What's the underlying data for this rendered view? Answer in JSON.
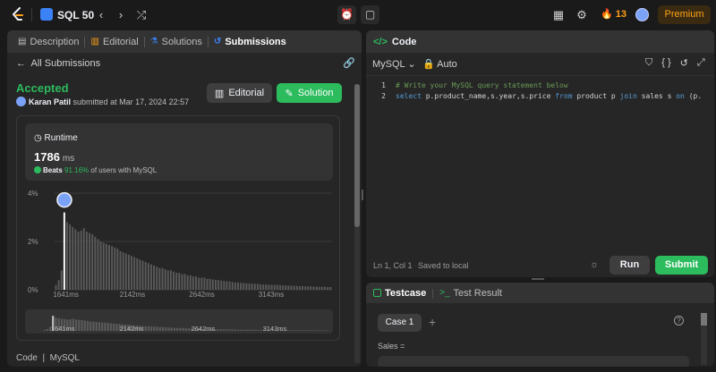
{
  "topbar": {
    "title": "SQL 50",
    "icons": [
      "leetcode-logo",
      "prev-icon",
      "next-icon",
      "shuffle-icon",
      "timer-icon",
      "notes-icon",
      "layout-icon",
      "settings-icon",
      "fire-icon",
      "avatar-icon"
    ],
    "streak_count": "13",
    "premium_label": "Premium",
    "colors": {
      "accent": "#ffa116",
      "success": "#2cbb5d"
    }
  },
  "left": {
    "tabs": [
      {
        "label": "Description",
        "icon": "description-icon"
      },
      {
        "label": "Editorial",
        "icon": "editorial-icon"
      },
      {
        "label": "Solutions",
        "icon": "flask-icon"
      },
      {
        "label": "Submissions",
        "icon": "history-icon",
        "active": true
      }
    ],
    "all_submissions": "All Submissions",
    "status": "Accepted",
    "author": "Karan Patil",
    "submitted_text": "submitted at Mar 17, 2024 22:57",
    "editorial_btn": "Editorial",
    "solution_btn": "Solution",
    "runtime": {
      "title": "Runtime",
      "value": "1786",
      "unit": "ms",
      "beats_label": "Beats",
      "beats_pct": "91.16%",
      "beats_suffix": "of users with MySQL"
    },
    "footer": {
      "code": "Code",
      "lang": "MySQL"
    }
  },
  "chart_data": {
    "type": "bar",
    "y_ticks": [
      "4%",
      "2%",
      "0%"
    ],
    "ylim": [
      0,
      4
    ],
    "x_ticks": [
      "1641ms",
      "2142ms",
      "2642ms",
      "3143ms"
    ],
    "user_bar_index": 3,
    "values": [
      0.2,
      0.4,
      0.8,
      3.2,
      2.8,
      2.7,
      2.6,
      2.5,
      2.4,
      2.45,
      2.55,
      2.4,
      2.35,
      2.3,
      2.2,
      2.1,
      2.0,
      1.95,
      1.9,
      1.85,
      1.8,
      1.75,
      1.7,
      1.6,
      1.55,
      1.5,
      1.45,
      1.4,
      1.35,
      1.3,
      1.25,
      1.2,
      1.15,
      1.1,
      1.05,
      1.0,
      0.95,
      0.9,
      0.9,
      0.85,
      0.8,
      0.8,
      0.75,
      0.7,
      0.7,
      0.65,
      0.65,
      0.6,
      0.6,
      0.55,
      0.55,
      0.5,
      0.5,
      0.5,
      0.45,
      0.45,
      0.42,
      0.4,
      0.4,
      0.38,
      0.36,
      0.35,
      0.34,
      0.32,
      0.3,
      0.3,
      0.29,
      0.28,
      0.27,
      0.26,
      0.25,
      0.25,
      0.24,
      0.23,
      0.22,
      0.22,
      0.21,
      0.2,
      0.2,
      0.2,
      0.19,
      0.18,
      0.18,
      0.17,
      0.17,
      0.16,
      0.16,
      0.15,
      0.15,
      0.14,
      0.14,
      0.14,
      0.13,
      0.13,
      0.12,
      0.12,
      0.12,
      0.11,
      0.11
    ]
  },
  "code": {
    "title": "Code",
    "language": "MySQL",
    "auto": "Auto",
    "lines": [
      {
        "num": "1",
        "text": "# Write your MySQL query statement below"
      },
      {
        "num": "2",
        "text": "select p.product_name,s.year,s.price from product p join sales s on (p."
      }
    ],
    "status": "Ln 1, Col 1",
    "saved": "Saved to local",
    "run_btn": "Run",
    "submit_btn": "Submit"
  },
  "testcase": {
    "tabs": [
      "Testcase",
      "Test Result"
    ],
    "case_label": "Case 1",
    "sales_label": "Sales ="
  }
}
